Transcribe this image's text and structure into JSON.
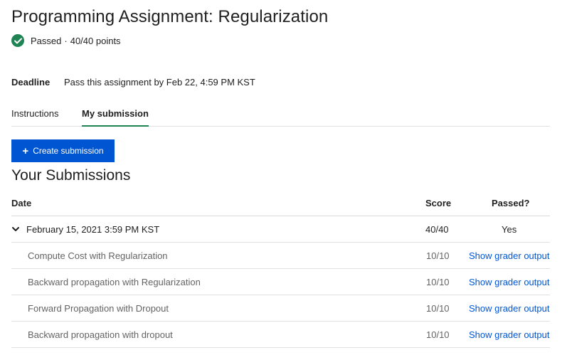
{
  "header": {
    "title": "Programming Assignment: Regularization",
    "status": "Passed",
    "separator": "·",
    "points": "40/40 points"
  },
  "deadline": {
    "label": "Deadline",
    "text": "Pass this assignment by Feb 22, 4:59 PM KST"
  },
  "tabs": [
    {
      "label": "Instructions"
    },
    {
      "label": "My submission"
    }
  ],
  "create_button": {
    "label": "Create submission"
  },
  "submissions": {
    "title": "Your Submissions",
    "columns": {
      "date": "Date",
      "score": "Score",
      "passed": "Passed?"
    },
    "main": {
      "date": "February 15, 2021 3:59 PM KST",
      "score": "40/40",
      "passed": "Yes"
    },
    "parts": [
      {
        "name": "Compute Cost with Regularization",
        "score": "10/10",
        "link": "Show grader output"
      },
      {
        "name": "Backward propagation with Regularization",
        "score": "10/10",
        "link": "Show grader output"
      },
      {
        "name": "Forward Propagation with Dropout",
        "score": "10/10",
        "link": "Show grader output"
      },
      {
        "name": "Backward propagation with dropout",
        "score": "10/10",
        "link": "Show grader output"
      }
    ]
  },
  "colors": {
    "accent": "#0056d2",
    "success": "#1f8354"
  }
}
